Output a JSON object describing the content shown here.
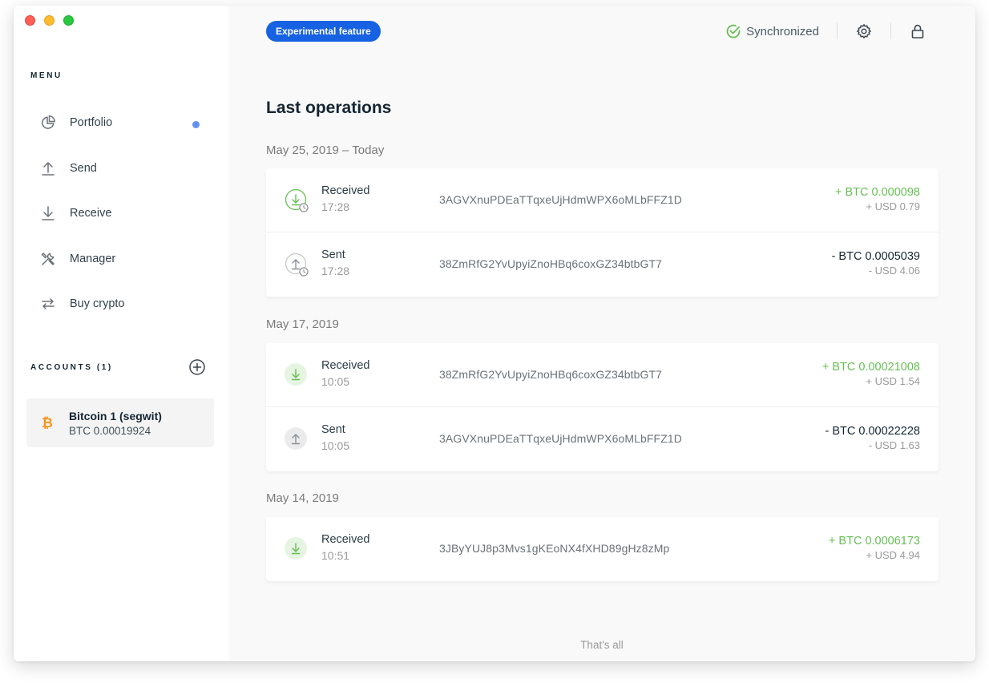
{
  "window": {
    "traffic_lights": [
      "close",
      "minimize",
      "zoom"
    ]
  },
  "sidebar": {
    "menu_title": "MENU",
    "items": [
      {
        "label": "Portfolio",
        "icon": "pie-chart-icon",
        "notification": true
      },
      {
        "label": "Send",
        "icon": "arrow-up-icon"
      },
      {
        "label": "Receive",
        "icon": "arrow-down-icon"
      },
      {
        "label": "Manager",
        "icon": "tools-icon"
      },
      {
        "label": "Buy crypto",
        "icon": "exchange-icon"
      }
    ],
    "accounts_title": "ACCOUNTS (1)",
    "accounts": [
      {
        "name": "Bitcoin 1 (segwit)",
        "balance": "BTC 0.00019924",
        "icon": "bitcoin-icon"
      }
    ]
  },
  "header": {
    "badge": "Experimental feature",
    "sync_status": "Synchronized"
  },
  "main": {
    "title": "Last operations",
    "groups": [
      {
        "date": "May 25, 2019 – Today",
        "operations": [
          {
            "type": "Received",
            "time": "17:28",
            "address": "3AGVXnuPDEaTTqxeUjHdmWPX6oMLbFFZ1D",
            "amount": "+ BTC 0.000098",
            "fiat": "+ USD 0.79",
            "direction": "in",
            "pending": true
          },
          {
            "type": "Sent",
            "time": "17:28",
            "address": "38ZmRfG2YvUpyiZnoHBq6coxGZ34btbGT7",
            "amount": "- BTC 0.0005039",
            "fiat": "- USD 4.06",
            "direction": "out",
            "pending": true
          }
        ]
      },
      {
        "date": "May 17, 2019",
        "operations": [
          {
            "type": "Received",
            "time": "10:05",
            "address": "38ZmRfG2YvUpyiZnoHBq6coxGZ34btbGT7",
            "amount": "+ BTC 0.00021008",
            "fiat": "+ USD 1.54",
            "direction": "in",
            "pending": false
          },
          {
            "type": "Sent",
            "time": "10:05",
            "address": "3AGVXnuPDEaTTqxeUjHdmWPX6oMLbFFZ1D",
            "amount": "- BTC 0.00022228",
            "fiat": "- USD 1.63",
            "direction": "out",
            "pending": false
          }
        ]
      },
      {
        "date": "May 14, 2019",
        "operations": [
          {
            "type": "Received",
            "time": "10:51",
            "address": "3JByYUJ8p3Mvs1gKEoNX4fXHD89gHz8zMp",
            "amount": "+ BTC 0.0006173",
            "fiat": "+ USD 4.94",
            "direction": "in",
            "pending": false
          }
        ]
      }
    ],
    "footer": "That's all"
  },
  "colors": {
    "accent": "#1762e2",
    "positive": "#66be54",
    "notification_dot": "#6490f1",
    "bitcoin": "#f7931a"
  }
}
